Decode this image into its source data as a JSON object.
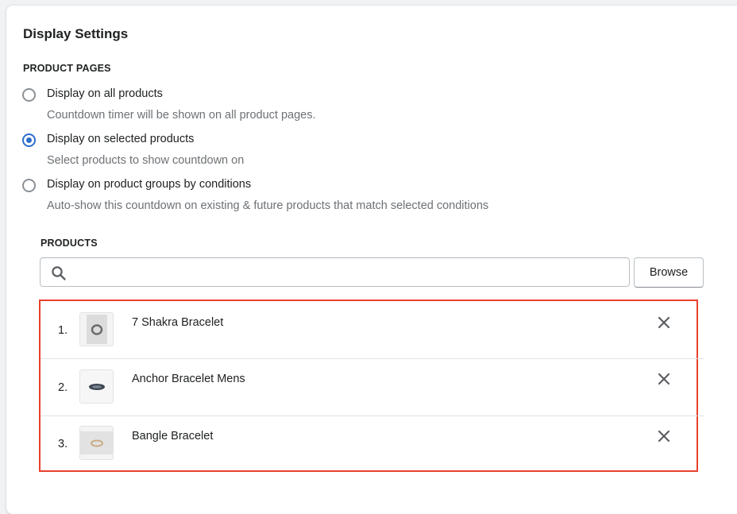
{
  "card": {
    "title": "Display Settings"
  },
  "product_pages": {
    "label": "PRODUCT PAGES",
    "options": [
      {
        "label": "Display on all products",
        "help": "Countdown timer will be shown on all product pages.",
        "checked": false
      },
      {
        "label": "Display on selected products",
        "help": "Select products to show countdown on",
        "checked": true
      },
      {
        "label": "Display on product groups by conditions",
        "help": "Auto-show this countdown on existing & future products that match selected conditions",
        "checked": false
      }
    ]
  },
  "products": {
    "label": "PRODUCTS",
    "search": {
      "placeholder": "",
      "value": ""
    },
    "browse_label": "Browse",
    "items": [
      {
        "index": "1.",
        "name": "7 Shakra Bracelet",
        "thumb_icon": "bracelet-thumbnail"
      },
      {
        "index": "2.",
        "name": "Anchor Bracelet Mens",
        "thumb_icon": "bracelet-thumbnail"
      },
      {
        "index": "3.",
        "name": "Bangle Bracelet",
        "thumb_icon": "bracelet-thumbnail"
      }
    ]
  },
  "colors": {
    "accent": "#2c6ecb",
    "highlight": "#e8412d"
  }
}
